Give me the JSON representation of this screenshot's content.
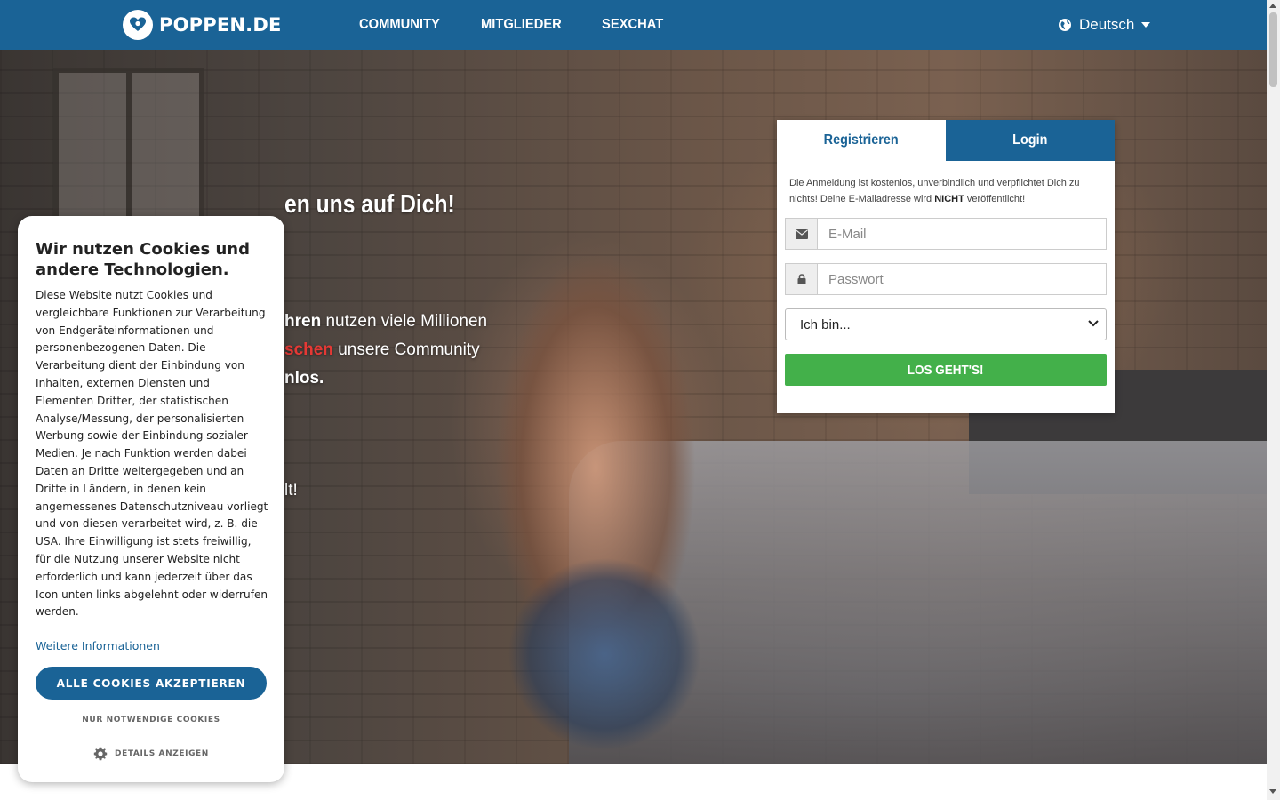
{
  "header": {
    "logo_text": "POPPEN.DE",
    "nav": [
      "COMMUNITY",
      "MITGLIEDER",
      "SEXCHAT"
    ],
    "language": "Deutsch",
    "brand_color": "#1a6396"
  },
  "hero": {
    "title": "en uns auf Dich!",
    "line1_bold": "hren",
    "line1_rest": " nutzen viele Millionen",
    "line2_red": "schen",
    "line2_rest": " unsere Community",
    "line3_bold": "nlos.",
    "line4": "lt!"
  },
  "register": {
    "tab_register": "Registrieren",
    "tab_login": "Login",
    "note_prefix": "Die Anmeldung ist kostenlos, unverbindlich und verpflichtet Dich zu nichts! Deine E-Mailadresse wird ",
    "note_bold": "NICHT",
    "note_suffix": " veröffentlicht!",
    "email_placeholder": "E-Mail",
    "password_placeholder": "Passwort",
    "select_value": "Ich bin...",
    "submit": "LOS GEHT'S!",
    "submit_color": "#43b04a"
  },
  "cookie": {
    "title": "Wir nutzen Cookies und andere Technologien.",
    "body": "Diese Website nutzt Cookies und vergleichbare Funktionen zur Verarbeitung von Endgeräteinformationen und personenbezogenen Daten. Die Verarbeitung dient der Einbindung von Inhalten, externen Diensten und Elementen Dritter, der statistischen Analyse/Messung, der personalisierten Werbung sowie der Einbindung sozialer Medien. Je nach Funktion werden dabei Daten an Dritte weitergegeben und an Dritte in Ländern, in denen kein angemessenes Datenschutzniveau vorliegt und von diesen verarbeitet wird, z. B. die USA. Ihre Einwilligung ist stets freiwillig, für die Nutzung unserer Website nicht erforderlich und kann jederzeit über das Icon unten links abgelehnt oder widerrufen werden.",
    "more_info": "Weitere Informationen",
    "accept_all": "ALLE COOKIES AKZEPTIEREN",
    "necessary_only": "NUR NOTWENDIGE COOKIES",
    "show_details": "DETAILS ANZEIGEN"
  },
  "icons": {
    "logo": "heart-icon",
    "language": "globe-icon",
    "email": "envelope-icon",
    "password": "lock-icon",
    "details": "gear-icon"
  }
}
